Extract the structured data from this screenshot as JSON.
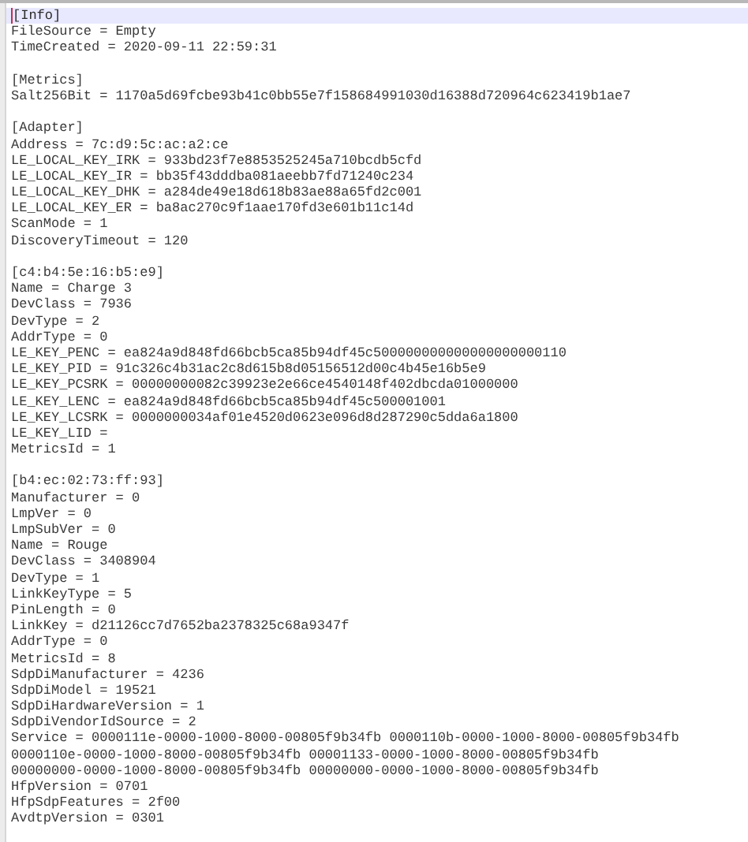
{
  "editor": {
    "lines": [
      {
        "kind": "text",
        "text": "[Info]",
        "current": true
      },
      {
        "kind": "text",
        "text": "FileSource = Empty",
        "current": false
      },
      {
        "kind": "text",
        "text": "TimeCreated = 2020-09-11 22:59:31",
        "current": false
      },
      {
        "kind": "blank",
        "current": false
      },
      {
        "kind": "text",
        "text": "[Metrics]",
        "current": false
      },
      {
        "kind": "text",
        "text": "Salt256Bit = 1170a5d69fcbe93b41c0bb55e7f158684991030d16388d720964c623419b1ae7",
        "current": false
      },
      {
        "kind": "blank",
        "current": false
      },
      {
        "kind": "text",
        "text": "[Adapter]",
        "current": false
      },
      {
        "kind": "text",
        "text": "Address = 7c:d9:5c:ac:a2:ce",
        "current": false
      },
      {
        "kind": "text",
        "text": "LE_LOCAL_KEY_IRK = 933bd23f7e8853525245a710bcdb5cfd",
        "current": false
      },
      {
        "kind": "text",
        "text": "LE_LOCAL_KEY_IR = bb35f43dddba081aeebb7fd71240c234",
        "current": false
      },
      {
        "kind": "text",
        "text": "LE_LOCAL_KEY_DHK = a284de49e18d618b83ae88a65fd2c001",
        "current": false
      },
      {
        "kind": "text",
        "text": "LE_LOCAL_KEY_ER = ba8ac270c9f1aae170fd3e601b11c14d",
        "current": false
      },
      {
        "kind": "text",
        "text": "ScanMode = 1",
        "current": false
      },
      {
        "kind": "text",
        "text": "DiscoveryTimeout = 120",
        "current": false
      },
      {
        "kind": "blank",
        "current": false
      },
      {
        "kind": "text",
        "text": "[c4:b4:5e:16:b5:e9]",
        "current": false
      },
      {
        "kind": "text",
        "text": "Name = Charge 3",
        "current": false
      },
      {
        "kind": "text",
        "text": "DevClass = 7936",
        "current": false
      },
      {
        "kind": "text",
        "text": "DevType = 2",
        "current": false
      },
      {
        "kind": "text",
        "text": "AddrType = 0",
        "current": false
      },
      {
        "kind": "text",
        "text": "LE_KEY_PENC = ea824a9d848fd66bcb5ca85b94df45c500000000000000000000110",
        "current": false
      },
      {
        "kind": "text",
        "text": "LE_KEY_PID = 91c326c4b31ac2c8d615b8d05156512d00c4b45e16b5e9",
        "current": false
      },
      {
        "kind": "text",
        "text": "LE_KEY_PCSRK = 00000000082c39923e2e66ce4540148f402dbcda01000000",
        "current": false
      },
      {
        "kind": "text",
        "text": "LE_KEY_LENC = ea824a9d848fd66bcb5ca85b94df45c500001001",
        "current": false
      },
      {
        "kind": "text",
        "text": "LE_KEY_LCSRK = 0000000034af01e4520d0623e096d8d287290c5dda6a1800",
        "current": false
      },
      {
        "kind": "text",
        "text": "LE_KEY_LID =",
        "current": false
      },
      {
        "kind": "text",
        "text": "MetricsId = 1",
        "current": false
      },
      {
        "kind": "blank",
        "current": false
      },
      {
        "kind": "text",
        "text": "[b4:ec:02:73:ff:93]",
        "current": false
      },
      {
        "kind": "text",
        "text": "Manufacturer = 0",
        "current": false
      },
      {
        "kind": "text",
        "text": "LmpVer = 0",
        "current": false
      },
      {
        "kind": "text",
        "text": "LmpSubVer = 0",
        "current": false
      },
      {
        "kind": "text",
        "text": "Name = Rouge",
        "current": false
      },
      {
        "kind": "text",
        "text": "DevClass = 3408904",
        "current": false
      },
      {
        "kind": "text",
        "text": "DevType = 1",
        "current": false
      },
      {
        "kind": "text",
        "text": "LinkKeyType = 5",
        "current": false
      },
      {
        "kind": "text",
        "text": "PinLength = 0",
        "current": false
      },
      {
        "kind": "text",
        "text": "LinkKey = d21126cc7d7652ba2378325c68a9347f",
        "current": false
      },
      {
        "kind": "text",
        "text": "AddrType = 0",
        "current": false
      },
      {
        "kind": "text",
        "text": "MetricsId = 8",
        "current": false
      },
      {
        "kind": "text",
        "text": "SdpDiManufacturer = 4236",
        "current": false
      },
      {
        "kind": "text",
        "text": "SdpDiModel = 19521",
        "current": false
      },
      {
        "kind": "text",
        "text": "SdpDiHardwareVersion = 1",
        "current": false
      },
      {
        "kind": "text",
        "text": "SdpDiVendorIdSource = 2",
        "current": false
      },
      {
        "kind": "text",
        "text": "Service = 0000111e-0000-1000-8000-00805f9b34fb 0000110b-0000-1000-8000-00805f9b34fb",
        "current": false
      },
      {
        "kind": "text",
        "text": "0000110e-0000-1000-8000-00805f9b34fb 00001133-0000-1000-8000-00805f9b34fb",
        "current": false
      },
      {
        "kind": "text",
        "text": "00000000-0000-1000-8000-00805f9b34fb 00000000-0000-1000-8000-00805f9b34fb",
        "current": false
      },
      {
        "kind": "text",
        "text": "HfpVersion = 0701",
        "current": false
      },
      {
        "kind": "text",
        "text": "HfpSdpFeatures = 2f00",
        "current": false
      },
      {
        "kind": "text",
        "text": "AvdtpVersion = 0301",
        "current": false
      }
    ]
  }
}
